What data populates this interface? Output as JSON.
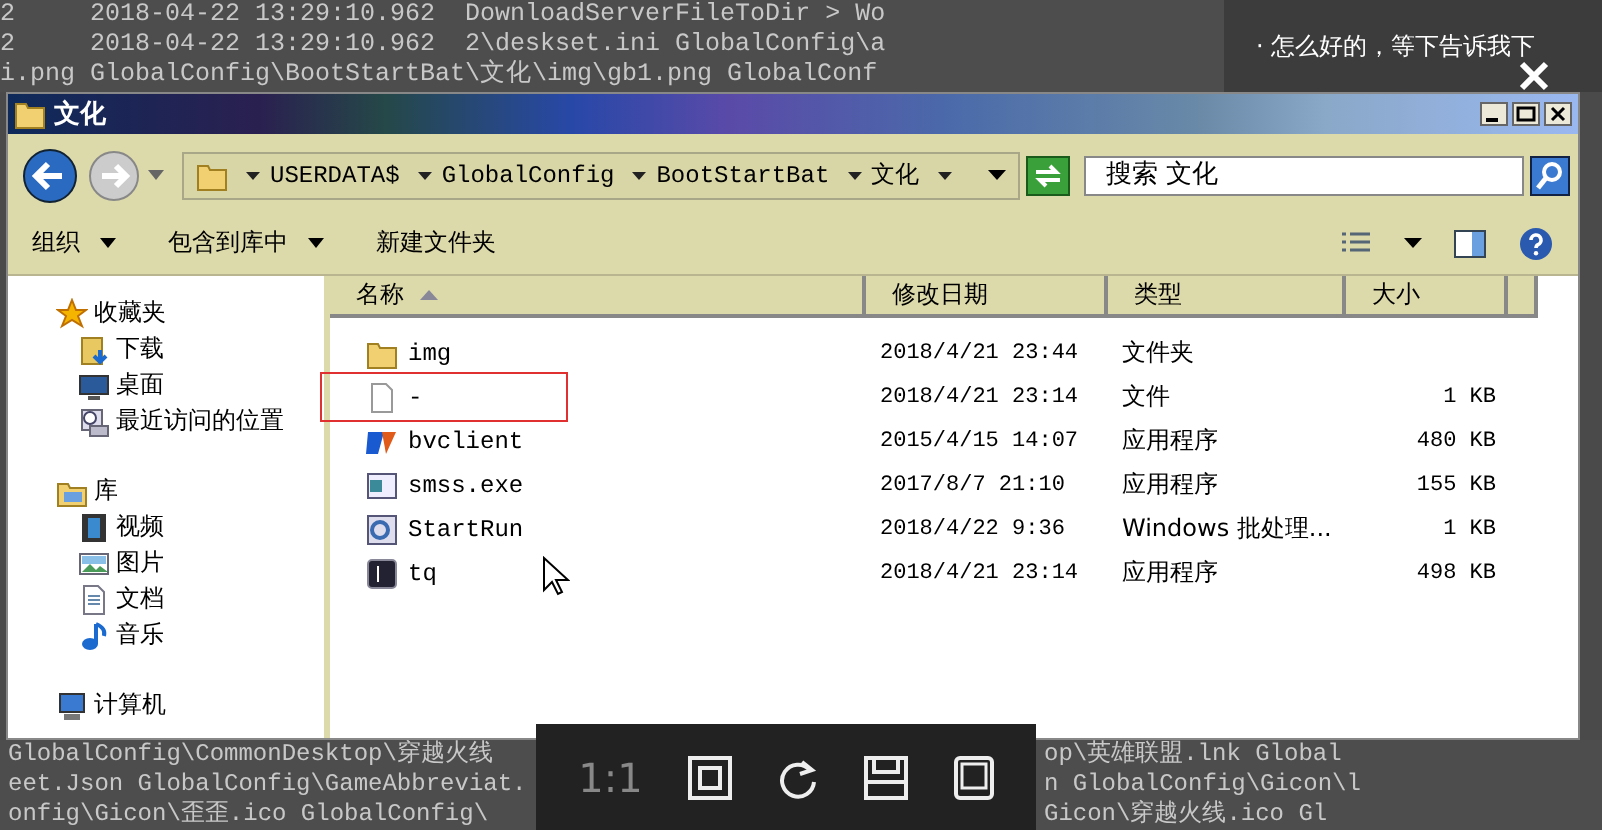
{
  "background_log": {
    "top_lines": [
      "2     2018-04-22 13:29:10.962  DownloadServerFileToDir > Wo",
      "2     2018-04-22 13:29:10.962  2\\deskset.ini GlobalConfig\\a",
      "i.png GlobalConfig\\BootStartBat\\文化\\img\\gb1.png GlobalConf"
    ],
    "bottom_lines": [
      {
        "left": "GlobalConfig\\CommonDesktop\\穿越火线",
        "right": "op\\英雄联盟.lnk Global"
      },
      {
        "left": "eet.Json GlobalConfig\\GameAbbreviat.",
        "right": "n GlobalConfig\\Gicon\\l"
      },
      {
        "left": "onfig\\Gicon\\歪歪.ico GlobalConfig\\",
        "right": "Gicon\\穿越火线.ico Gl"
      }
    ]
  },
  "chat": {
    "messages": [
      "· 怎么好的，等下告诉我下"
    ]
  },
  "viewer": {
    "zoom_label": "1:1"
  },
  "window": {
    "title": "文化",
    "breadcrumb": [
      "USERDATA$",
      "GlobalConfig",
      "BootStartBat",
      "文化"
    ],
    "search": {
      "placeholder": "搜索 文化"
    },
    "toolbar": [
      "组织",
      "包含到库中",
      "新建文件夹"
    ],
    "sidebar": [
      {
        "label": "收藏夹",
        "children": [
          {
            "label": "下载"
          },
          {
            "label": "桌面"
          },
          {
            "label": "最近访问的位置"
          }
        ]
      },
      {
        "label": "库",
        "children": [
          {
            "label": "视频"
          },
          {
            "label": "图片"
          },
          {
            "label": "文档"
          },
          {
            "label": "音乐"
          }
        ]
      },
      {
        "label": "计算机"
      }
    ],
    "columns": [
      "名称",
      "修改日期",
      "类型",
      "大小"
    ],
    "rows": [
      {
        "name": "img",
        "date": "2018/4/21 23:44",
        "type": "文件夹",
        "size": ""
      },
      {
        "name": "-",
        "date": "2018/4/21 23:14",
        "type": "文件",
        "size": "1 KB"
      },
      {
        "name": "bvclient",
        "date": "2015/4/15 14:07",
        "type": "应用程序",
        "size": "480 KB"
      },
      {
        "name": "smss.exe",
        "date": "2017/8/7 21:10",
        "type": "应用程序",
        "size": "155 KB"
      },
      {
        "name": "StartRun",
        "date": "2018/4/22 9:36",
        "type": "Windows 批处理...",
        "size": "1 KB"
      },
      {
        "name": "tq",
        "date": "2018/4/21 23:14",
        "type": "应用程序",
        "size": "498 KB"
      }
    ]
  }
}
